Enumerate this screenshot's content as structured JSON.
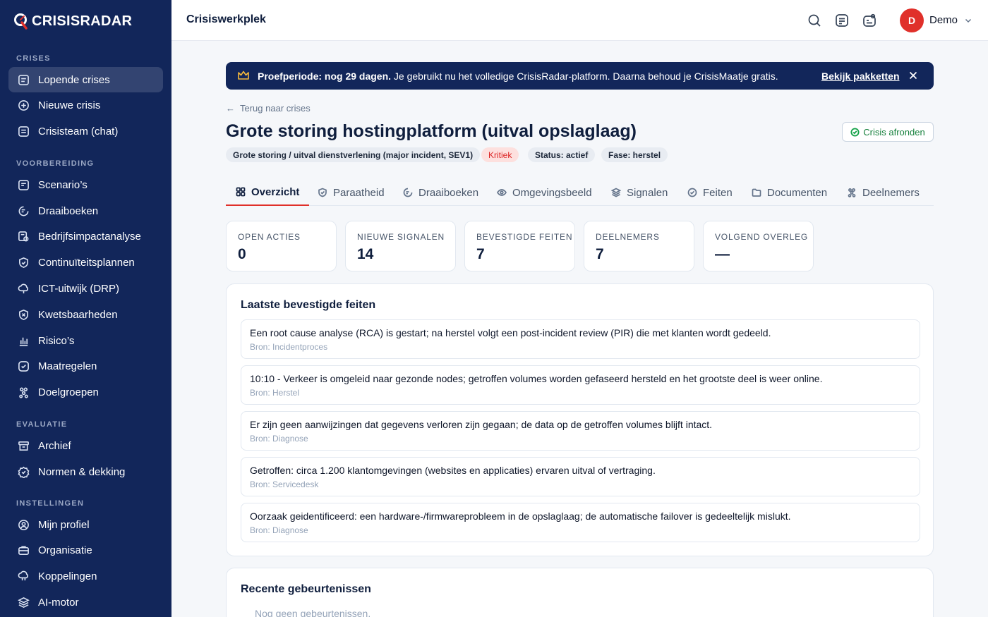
{
  "app": {
    "brand": "CRISISRADAR",
    "colors": {
      "sidebar": "#12265a",
      "accent": "#e0302a",
      "success": "#16a34a"
    }
  },
  "sidebar": {
    "sections": [
      {
        "label": "CRISES",
        "items": [
          {
            "label": "Lopende crises",
            "icon": "list-icon",
            "active": true
          },
          {
            "label": "Nieuwe crisis",
            "icon": "plus-circle-icon"
          },
          {
            "label": "Crisisteam (chat)",
            "icon": "chat-icon"
          }
        ]
      },
      {
        "label": "VOORBEREIDING",
        "items": [
          {
            "label": "Scenario’s",
            "icon": "scenario-icon"
          },
          {
            "label": "Draaiboeken",
            "icon": "book-icon"
          },
          {
            "label": "Bedrijfsimpactanalyse",
            "icon": "analysis-icon"
          },
          {
            "label": "Continuïteitsplannen",
            "icon": "shield-icon"
          },
          {
            "label": "ICT-uitwijk (DRP)",
            "icon": "cloud-icon"
          },
          {
            "label": "Kwetsbaarheden",
            "icon": "shield-x-icon"
          },
          {
            "label": "Risico’s",
            "icon": "bar-chart-icon"
          },
          {
            "label": "Maatregelen",
            "icon": "check-square-icon"
          },
          {
            "label": "Doelgroepen",
            "icon": "users-icon"
          }
        ]
      },
      {
        "label": "EVALUATIE",
        "items": [
          {
            "label": "Archief",
            "icon": "archive-icon"
          },
          {
            "label": "Normen & dekking",
            "icon": "badge-check-icon"
          }
        ]
      },
      {
        "label": "INSTELLINGEN",
        "items": [
          {
            "label": "Mijn profiel",
            "icon": "user-circle-icon"
          },
          {
            "label": "Organisatie",
            "icon": "briefcase-icon"
          },
          {
            "label": "Koppelingen",
            "icon": "plug-icon"
          },
          {
            "label": "AI-motor",
            "icon": "layers-icon"
          }
        ]
      }
    ]
  },
  "topbar": {
    "title": "Crisiswerkplek",
    "user_initial": "D",
    "user_name": "Demo"
  },
  "banner": {
    "bold": "Proefperiode: nog 29 dagen.",
    "text": " Je gebruikt nu het volledige CrisisRadar-platform. Daarna behoud je CrisisMaatje gratis.",
    "link": "Bekijk pakketten"
  },
  "crisis": {
    "back": "Terug naar crises",
    "title": "Grote storing hostingplatform (uitval opslaglaag)",
    "finish_button": "Crisis afronden",
    "chips": {
      "type": "Grote storing / uitval dienstverlening (major incident, SEV1)",
      "severity": "Kritiek",
      "status": "Status: actief",
      "phase": "Fase: herstel"
    }
  },
  "tabs": [
    {
      "label": "Overzicht",
      "icon": "grid-icon",
      "active": true
    },
    {
      "label": "Paraatheid",
      "icon": "shield-check-icon"
    },
    {
      "label": "Draaiboeken",
      "icon": "book-icon"
    },
    {
      "label": "Omgevingsbeeld",
      "icon": "eye-icon"
    },
    {
      "label": "Signalen",
      "icon": "layers-icon"
    },
    {
      "label": "Feiten",
      "icon": "check-circle-icon"
    },
    {
      "label": "Documenten",
      "icon": "folder-icon"
    },
    {
      "label": "Deelnemers",
      "icon": "users-icon"
    }
  ],
  "stats": [
    {
      "label": "OPEN ACTIES",
      "value": "0"
    },
    {
      "label": "NIEUWE SIGNALEN",
      "value": "14"
    },
    {
      "label": "BEVESTIGDE FEITEN",
      "value": "7"
    },
    {
      "label": "DEELNEMERS",
      "value": "7"
    },
    {
      "label": "VOLGEND OVERLEG",
      "value": "—"
    }
  ],
  "facts_panel": {
    "title": "Laatste bevestigde feiten",
    "items": [
      {
        "text": "Een root cause analyse (RCA) is gestart; na herstel volgt een post-incident review (PIR) die met klanten wordt gedeeld.",
        "source": "Bron: Incidentproces"
      },
      {
        "text": "10:10 - Verkeer is omgeleid naar gezonde nodes; getroffen volumes worden gefaseerd hersteld en het grootste deel is weer online.",
        "source": "Bron: Herstel"
      },
      {
        "text": "Er zijn geen aanwijzingen dat gegevens verloren zijn gegaan; de data op de getroffen volumes blijft intact.",
        "source": "Bron: Diagnose"
      },
      {
        "text": "Getroffen: circa 1.200 klantomgevingen (websites en applicaties) ervaren uitval of vertraging.",
        "source": "Bron: Servicedesk"
      },
      {
        "text": "Oorzaak geidentificeerd: een hardware-/firmwareprobleem in de opslaglaag; de automatische failover is gedeeltelijk mislukt.",
        "source": "Bron: Diagnose"
      }
    ]
  },
  "events_panel": {
    "title": "Recente gebeurtenissen",
    "empty": "Nog geen gebeurtenissen."
  }
}
